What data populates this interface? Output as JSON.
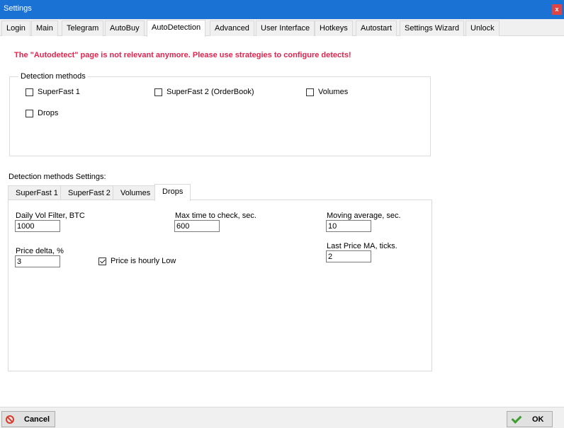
{
  "window": {
    "title": "Settings",
    "close_label": "x"
  },
  "main_tabs": [
    {
      "label": "Login"
    },
    {
      "label": "Main"
    },
    {
      "label": "Telegram"
    },
    {
      "label": "AutoBuy"
    },
    {
      "label": "AutoDetection",
      "active": true
    },
    {
      "label": "Advanced"
    },
    {
      "label": "User Interface"
    },
    {
      "label": "Hotkeys"
    },
    {
      "label": "Autostart"
    },
    {
      "label": "Settings Wizard"
    },
    {
      "label": "Unlock"
    }
  ],
  "warning_text": "The \"Autodetect\" page is not relevant anymore. Please use strategies to configure detects!",
  "detection_methods": {
    "legend": "Detection methods",
    "superfast1": {
      "label": "SuperFast 1",
      "checked": false
    },
    "superfast2": {
      "label": "SuperFast 2 (OrderBook)",
      "checked": false
    },
    "volumes": {
      "label": "Volumes",
      "checked": false
    },
    "drops": {
      "label": "Drops",
      "checked": false
    }
  },
  "settings_section": {
    "label": "Detection methods Settings:",
    "tabs": [
      {
        "label": "SuperFast 1"
      },
      {
        "label": "SuperFast 2"
      },
      {
        "label": "Volumes"
      },
      {
        "label": "Drops",
        "active": true
      }
    ]
  },
  "drops_panel": {
    "daily_vol_filter": {
      "label": "Daily Vol Filter,  BTC",
      "value": "1000"
    },
    "max_time_to_check": {
      "label": "Max time to check, sec.",
      "value": "600"
    },
    "moving_average": {
      "label": "Moving average, sec.",
      "value": "10"
    },
    "price_delta": {
      "label": "Price delta, %",
      "value": "3"
    },
    "price_is_hourly_low": {
      "label": "Price is hourly Low",
      "checked": true
    },
    "last_price_ma": {
      "label": "Last Price MA, ticks.",
      "value": "2"
    }
  },
  "footer": {
    "cancel_label": "Cancel",
    "ok_label": "OK"
  }
}
